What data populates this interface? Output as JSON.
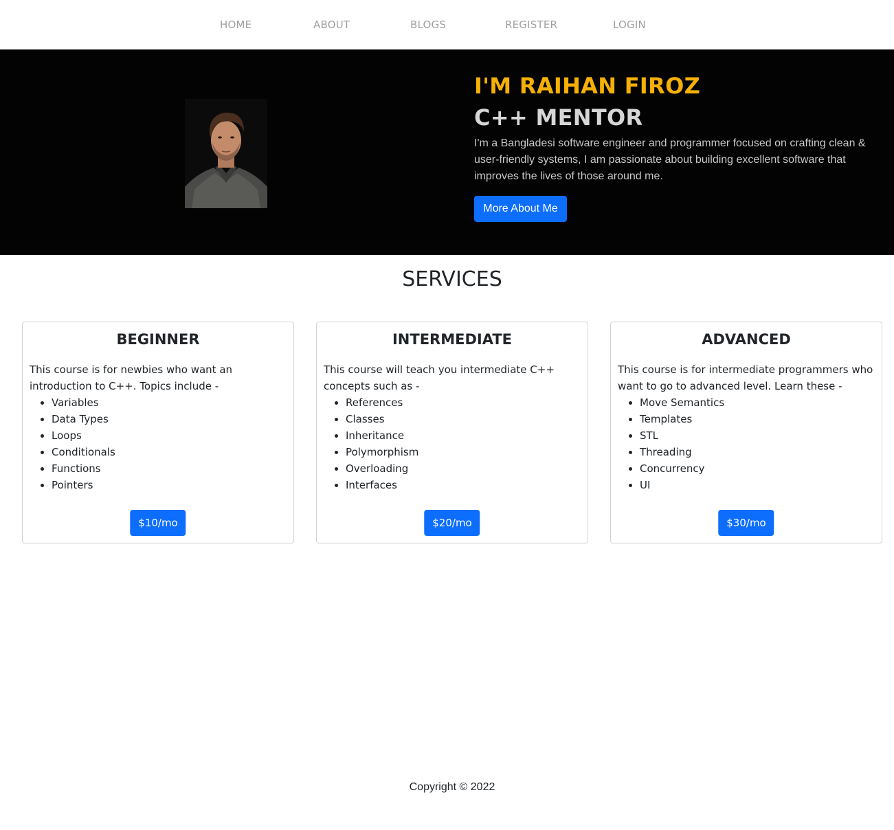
{
  "nav": {
    "items": [
      {
        "label": "HOME"
      },
      {
        "label": "ABOUT"
      },
      {
        "label": "BLOGS"
      },
      {
        "label": "REGISTER"
      },
      {
        "label": "LOGIN"
      }
    ]
  },
  "hero": {
    "name": "I'M RAIHAN FIROZ",
    "role": "C++ MENTOR",
    "description": "I'm a Bangladesi software engineer and programmer focused on crafting clean & user-friendly systems, I am passionate about building excellent software that improves the lives of those around me.",
    "button_label": "More About Me",
    "name_color": "#f5b005",
    "button_color": "#0d6efd"
  },
  "services": {
    "title": "SERVICES",
    "cards": [
      {
        "title": "BEGINNER",
        "description": "This course is for newbies who want an introduction to C++. Topics include -",
        "topics": [
          "Variables",
          "Data Types",
          "Loops",
          "Conditionals",
          "Functions",
          "Pointers"
        ],
        "price": "$10/mo"
      },
      {
        "title": "INTERMEDIATE",
        "description": "This course will teach you intermediate C++ concepts such as -",
        "topics": [
          "References",
          "Classes",
          "Inheritance",
          "Polymorphism",
          "Overloading",
          "Interfaces"
        ],
        "price": "$20/mo"
      },
      {
        "title": "ADVANCED",
        "description": "This course is for intermediate programmers who want to go to advanced level. Learn these -",
        "topics": [
          "Move Semantics",
          "Templates",
          "STL",
          "Threading",
          "Concurrency",
          "UI"
        ],
        "price": "$30/mo"
      }
    ]
  },
  "footer": {
    "copyright": "Copyright © 2022"
  }
}
